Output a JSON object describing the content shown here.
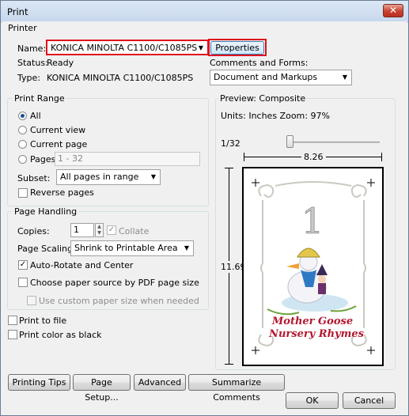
{
  "window": {
    "title": "Print",
    "close_glyph": "✕"
  },
  "printer": {
    "group_title": "Printer",
    "name_label": "Name:",
    "name_value": "KONICA MINOLTA C1100/C1085PS",
    "properties_label": "Properties",
    "status_label": "Status:",
    "status_value": "Ready",
    "type_label": "Type:",
    "type_value": "KONICA MINOLTA C1100/C1085PS",
    "comments_label": "Comments and Forms:",
    "comments_value": "Document and Markups",
    "highlight_color": "#e0101c"
  },
  "print_range": {
    "group_title": "Print Range",
    "options": [
      "All",
      "Current view",
      "Current page",
      "Pages"
    ],
    "selected": "All",
    "pages_placeholder": "1 - 32",
    "subset_label": "Subset:",
    "subset_value": "All pages in range",
    "reverse_label": "Reverse pages"
  },
  "page_handling": {
    "group_title": "Page Handling",
    "copies_label": "Copies:",
    "copies_value": "1",
    "collate_label": "Collate",
    "scaling_label": "Page Scaling:",
    "scaling_value": "Shrink to Printable Area",
    "auto_rotate_label": "Auto-Rotate and Center",
    "auto_rotate_checked": true,
    "paper_source_label": "Choose paper source by PDF page size",
    "custom_paper_label": "Use custom paper size when needed"
  },
  "options": {
    "print_to_file_label": "Print to file",
    "color_as_black_label": "Print color as black"
  },
  "preview": {
    "group_title": "Preview: Composite",
    "units_text": "Units: Inches Zoom:  97%",
    "page_indicator": "1/32",
    "width_value": "8.26",
    "height_value": "11.69",
    "page_number_art": "1",
    "book_title_line1": "Mother Goose",
    "book_title_line2": "Nursery Rhymes"
  },
  "buttons": {
    "printing_tips": "Printing Tips",
    "page_setup": "Page Setup...",
    "advanced": "Advanced",
    "summarize": "Summarize Comments",
    "ok": "OK",
    "cancel": "Cancel"
  }
}
